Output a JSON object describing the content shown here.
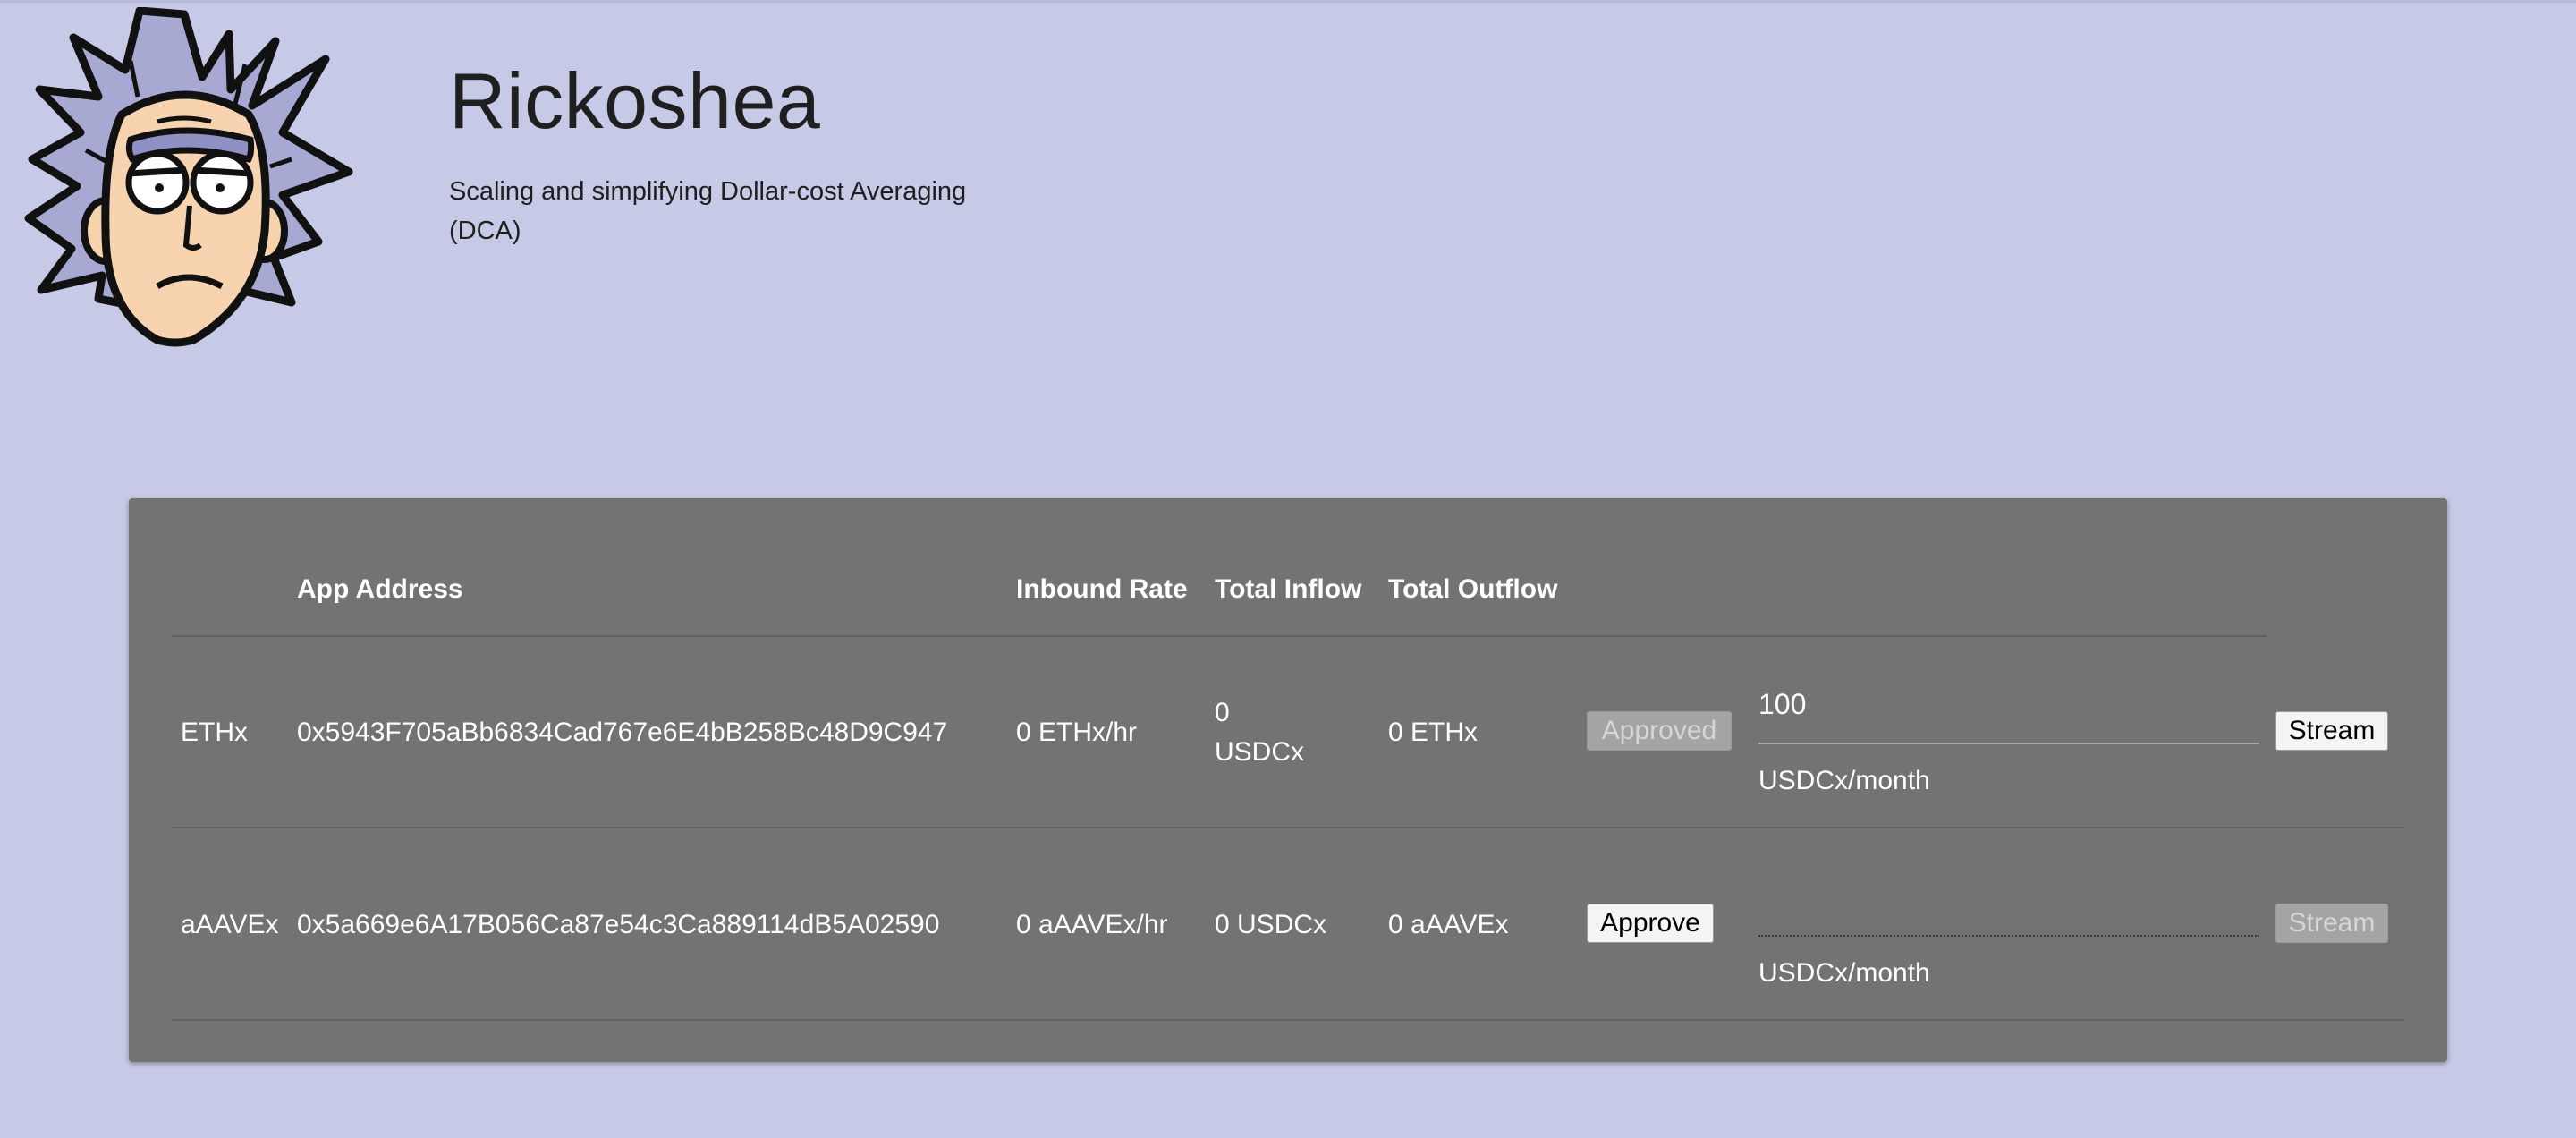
{
  "header": {
    "title": "Rickoshea",
    "subtitle": "Scaling and simplifying Dollar-cost Averaging (DCA)"
  },
  "table": {
    "columns": [
      "",
      "App Address",
      "Inbound Rate",
      "Total Inflow",
      "Total Outflow"
    ],
    "rows": [
      {
        "token": "ETHx",
        "app_address": "0x5943F705aBb6834Cad767e6E4bB258Bc48D9C947",
        "inbound_rate": "0 ETHx/hr",
        "total_inflow_value": "0",
        "total_inflow_unit": "USDCx",
        "total_outflow": "0 ETHx",
        "approve_label": "Approved",
        "approve_enabled": false,
        "amount_value": "100",
        "amount_unit": "USDCx/month",
        "stream_label": "Stream",
        "stream_enabled": true
      },
      {
        "token": "aAAVEx",
        "app_address": "0x5a669e6A17B056Ca87e54c3Ca889114dB5A02590",
        "inbound_rate": "0 aAAVEx/hr",
        "total_inflow": "0 USDCx",
        "total_outflow": "0 aAAVEx",
        "approve_label": "Approve",
        "approve_enabled": true,
        "amount_value": "",
        "amount_unit": "USDCx/month",
        "stream_label": "Stream",
        "stream_enabled": false
      }
    ]
  },
  "colors": {
    "page_background": "#c7cae6",
    "panel_background": "#737373",
    "text_on_panel": "#ffffff"
  },
  "icons": {
    "logo": "rick-face-logo"
  }
}
